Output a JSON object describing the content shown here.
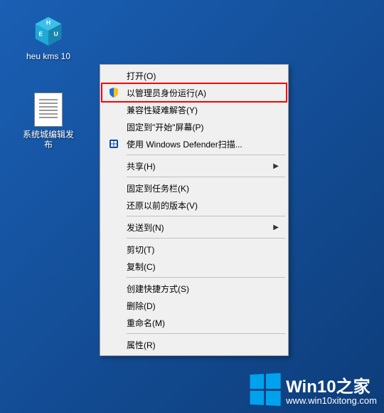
{
  "desktop": {
    "icons": [
      {
        "id": "heu-kms",
        "label": "heu kms 10"
      },
      {
        "id": "txt-file",
        "label": "系统城编辑发布"
      }
    ]
  },
  "context_menu": {
    "items": [
      {
        "id": "open",
        "label": "打开(O)",
        "icon": "",
        "submenu": false
      },
      {
        "id": "run-as-admin",
        "label": "以管理员身份运行(A)",
        "icon": "shield",
        "submenu": false,
        "highlighted": true
      },
      {
        "id": "compat-troubleshoot",
        "label": "兼容性疑难解答(Y)",
        "icon": "",
        "submenu": false
      },
      {
        "id": "pin-start",
        "label": "固定到\"开始\"屏幕(P)",
        "icon": "",
        "submenu": false
      },
      {
        "id": "defender-scan",
        "label": "使用 Windows Defender扫描...",
        "icon": "defender",
        "submenu": false
      },
      {
        "sep": true
      },
      {
        "id": "share",
        "label": "共享(H)",
        "icon": "",
        "submenu": true
      },
      {
        "sep": true
      },
      {
        "id": "pin-taskbar",
        "label": "固定到任务栏(K)",
        "icon": "",
        "submenu": false
      },
      {
        "id": "restore-prev",
        "label": "还原以前的版本(V)",
        "icon": "",
        "submenu": false
      },
      {
        "sep": true
      },
      {
        "id": "send-to",
        "label": "发送到(N)",
        "icon": "",
        "submenu": true
      },
      {
        "sep": true
      },
      {
        "id": "cut",
        "label": "剪切(T)",
        "icon": "",
        "submenu": false
      },
      {
        "id": "copy",
        "label": "复制(C)",
        "icon": "",
        "submenu": false
      },
      {
        "sep": true
      },
      {
        "id": "create-shortcut",
        "label": "创建快捷方式(S)",
        "icon": "",
        "submenu": false
      },
      {
        "id": "delete",
        "label": "删除(D)",
        "icon": "",
        "submenu": false
      },
      {
        "id": "rename",
        "label": "重命名(M)",
        "icon": "",
        "submenu": false
      },
      {
        "sep": true
      },
      {
        "id": "properties",
        "label": "属性(R)",
        "icon": "",
        "submenu": false
      }
    ]
  },
  "watermark": {
    "title": "Win10之家",
    "url": "www.win10xitong.com"
  },
  "colors": {
    "highlight": "#ff0000",
    "win_logo": "#00a2ed"
  }
}
